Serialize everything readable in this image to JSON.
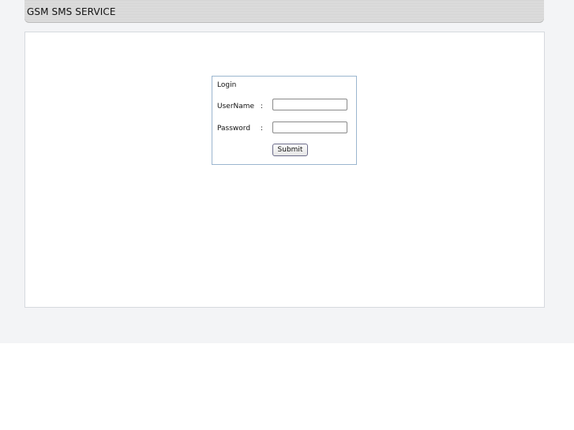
{
  "header": {
    "title": "GSM SMS SERVICE"
  },
  "login": {
    "title": "Login",
    "username_label": "UserName",
    "password_label": "Password",
    "separator": ":",
    "username_value": "",
    "password_value": "",
    "submit_label": "Submit"
  }
}
